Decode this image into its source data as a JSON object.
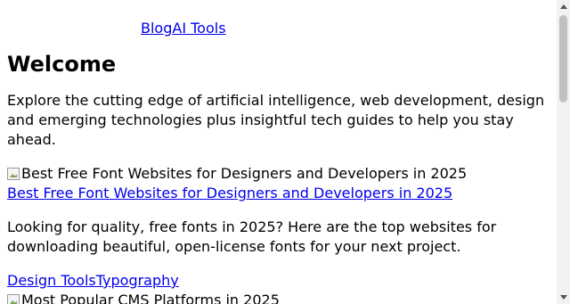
{
  "nav": {
    "links": [
      "Blog",
      "AI Tools"
    ]
  },
  "page": {
    "heading": "Welcome",
    "intro": "Explore the cutting edge of artificial intelligence, web development, design and emerging technologies plus insightful tech guides to help you stay ahead."
  },
  "posts": [
    {
      "image_alt": "Best Free Font Websites for Designers and Developers in 2025",
      "title": "Best Free Font Websites for Designers and Developers in 2025",
      "excerpt": "Looking for quality, free fonts in 2025? Here are the top websites for downloading beautiful, open-license fonts for your next project.",
      "tags": [
        "Design Tools",
        "Typography"
      ]
    },
    {
      "image_alt": "Most Popular CMS Platforms in 2025"
    }
  ],
  "icons": {
    "broken_image": "broken-image-icon",
    "scroll_up": "scroll-up-arrow-icon",
    "scroll_down": "scroll-down-arrow-icon"
  },
  "colors": {
    "link": "#0000ee",
    "text": "#000000",
    "background": "#ffffff",
    "scrollbar_track": "#f1f1f1",
    "scrollbar_thumb": "#c1c1c1"
  }
}
